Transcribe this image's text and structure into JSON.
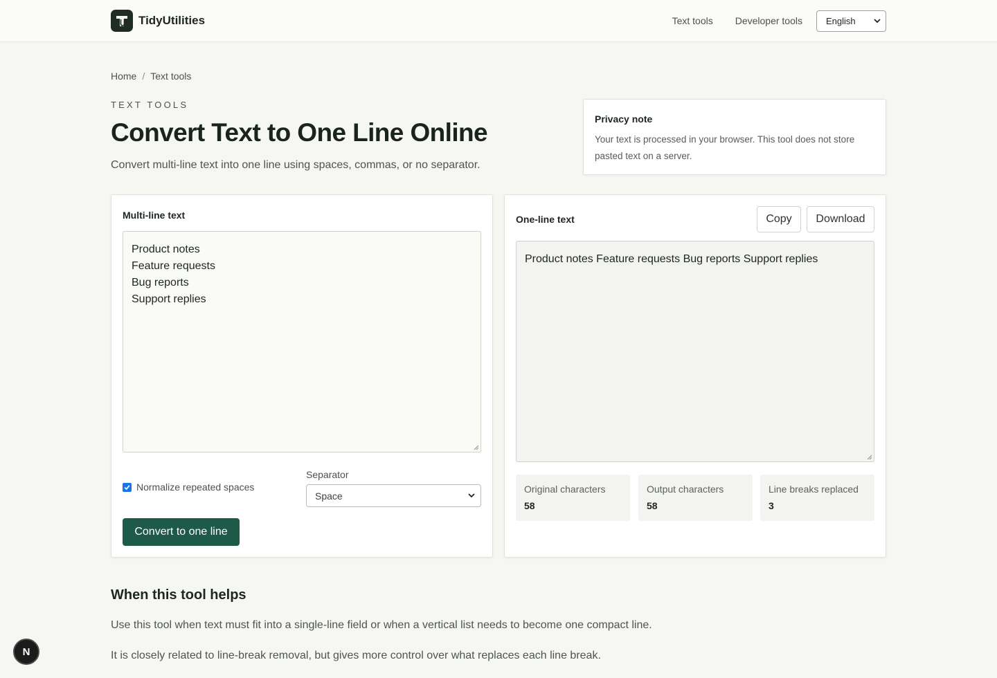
{
  "header": {
    "brand_name": "TidyUtilities",
    "nav": [
      {
        "label": "Text tools"
      },
      {
        "label": "Developer tools"
      }
    ],
    "language": "English"
  },
  "breadcrumb": {
    "home": "Home",
    "separator": "/",
    "current": "Text tools"
  },
  "hero": {
    "eyebrow": "TEXT TOOLS",
    "title": "Convert Text to One Line Online",
    "subtitle": "Convert multi-line text into one line using spaces, commas, or no separator."
  },
  "privacy": {
    "title": "Privacy note",
    "text": "Your text is processed in your browser. This tool does not store pasted text on a server."
  },
  "input_panel": {
    "label": "Multi-line text",
    "lines": [
      "Product notes",
      "Feature requests",
      "Bug reports",
      "Support replies"
    ],
    "normalize_label": "Normalize repeated spaces",
    "normalize_checked": true,
    "separator_label": "Separator",
    "separator_value": "Space",
    "convert_label": "Convert to one line"
  },
  "output_panel": {
    "label": "One-line text",
    "copy_label": "Copy",
    "download_label": "Download",
    "value": "Product notes Feature requests Bug reports Support replies",
    "stats": [
      {
        "label": "Original characters",
        "value": "58"
      },
      {
        "label": "Output characters",
        "value": "58"
      },
      {
        "label": "Line breaks replaced",
        "value": "3"
      }
    ]
  },
  "info": {
    "title": "When this tool helps",
    "paragraphs": [
      "Use this tool when text must fit into a single-line field or when a vertical list needs to become one compact line.",
      "It is closely related to line-break removal, but gives more control over what replaces each line break."
    ]
  },
  "colors": {
    "primary_button": "#1e5a48",
    "checkbox": "#1a73e8",
    "page_background": "#f6f6f3"
  },
  "icons": {
    "logo": "tidyutilities-logo-icon",
    "dropdown": "chevron-down-icon",
    "badge": "nextjs-badge-icon"
  }
}
